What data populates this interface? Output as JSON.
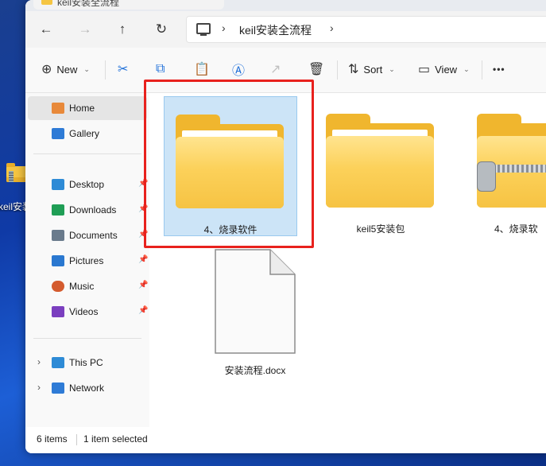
{
  "window": {
    "tab_title": "keil安装全流程"
  },
  "address_bar": {
    "back_icon": "←",
    "forward_icon": "→",
    "up_icon": "↑",
    "refresh_icon": "↻",
    "separator": "›",
    "crumb": "keil安装全流程"
  },
  "toolbar": {
    "new_label": "New",
    "new_icon": "⊕",
    "cut_icon": "✂",
    "copy_icon": "⧉",
    "paste_icon": "📋",
    "rename_icon": "Ⓐ",
    "share_icon": "↗",
    "delete_icon": "🗑",
    "sort_label": "Sort",
    "sort_icon": "⇅",
    "view_label": "View",
    "view_icon": "▭",
    "more_icon": "•••",
    "caret": "⌄"
  },
  "sidebar": {
    "items": [
      {
        "label": "Home",
        "icon": "home-icon",
        "color": "#e8893a"
      },
      {
        "label": "Gallery",
        "icon": "gallery-icon",
        "color": "#2e7bd6"
      },
      {
        "label": "Desktop",
        "icon": "desktop-icon",
        "color": "#2e8bd6"
      },
      {
        "label": "Downloads",
        "icon": "download-icon",
        "color": "#1f9e55"
      },
      {
        "label": "Documents",
        "icon": "documents-icon",
        "color": "#6a7b8c"
      },
      {
        "label": "Pictures",
        "icon": "pictures-icon",
        "color": "#2a78d0"
      },
      {
        "label": "Music",
        "icon": "music-icon",
        "color": "#d45b2e"
      },
      {
        "label": "Videos",
        "icon": "videos-icon",
        "color": "#7b3fbf"
      },
      {
        "label": "This PC",
        "icon": "pc-icon",
        "color": "#2e8bd6"
      },
      {
        "label": "Network",
        "icon": "network-icon",
        "color": "#2e7bd6"
      }
    ],
    "pin_glyph": "📌",
    "expander_glyph": "›"
  },
  "files": [
    {
      "name": "4、烧录软件",
      "type": "folder",
      "selected": true
    },
    {
      "name": "keil5安装包",
      "type": "folder",
      "selected": false
    },
    {
      "name": "4、烧录软",
      "type": "zip-folder",
      "selected": false
    },
    {
      "name": "安装流程.docx",
      "type": "document",
      "selected": false
    }
  ],
  "desktop": {
    "icon_label": "keil安装"
  },
  "status": {
    "count": "6 items",
    "selection": "1 item selected"
  },
  "colors": {
    "selection_bg": "#cce4f7",
    "highlight_box": "#e8211d",
    "folder_yellow": "#f6c343"
  }
}
